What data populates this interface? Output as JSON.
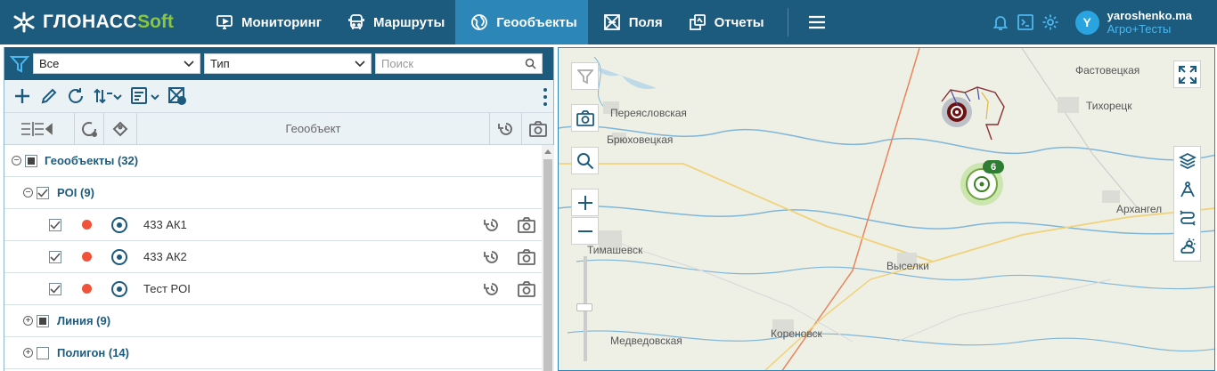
{
  "app": {
    "logo_word": "ГЛОНАСС",
    "logo_soft": "Soft"
  },
  "nav": [
    {
      "label": "Мониторинг",
      "icon": "monitor-icon"
    },
    {
      "label": "Маршруты",
      "icon": "bus-icon"
    },
    {
      "label": "Геообъекты",
      "icon": "globe-icon",
      "active": true
    },
    {
      "label": "Поля",
      "icon": "field-icon"
    },
    {
      "label": "Отчеты",
      "icon": "reports-icon"
    }
  ],
  "user": {
    "avatar_letter": "Y",
    "name": "yaroshenko.ma",
    "org": "Агро+Тесты"
  },
  "filters": {
    "scope": "Все",
    "type": "Тип",
    "search_placeholder": "Поиск"
  },
  "columns": {
    "geoobject": "Геообъект"
  },
  "tree": {
    "root": {
      "label": "Геообъекты (32)"
    },
    "poi": {
      "label": "POI (9)"
    },
    "items": [
      {
        "label": "433 АК1"
      },
      {
        "label": "433 АК2"
      },
      {
        "label": "Тест POI"
      }
    ],
    "line": {
      "label": "Линия (9)"
    },
    "polygon": {
      "label": "Полигон (14)"
    }
  },
  "map": {
    "labels": {
      "pereyaslovskaya": "Переясловская",
      "bryukhovetskaya": "Брюховецкая",
      "timashevsk": "Тимашевск",
      "vyselki": "Выселки",
      "medvedovskaya": "Медведовская",
      "korenovsk": "Кореновск",
      "fastovetskaya": "Фастовецкая",
      "tikhoretsk": "Тихорецк",
      "arkhangel": "Архангел"
    },
    "cluster_count": "6"
  },
  "colors": {
    "topbar": "#1d5b7e",
    "active_tab": "#2c87b8",
    "poi_dot": "#f0533a",
    "cluster": "#2e7d32"
  }
}
